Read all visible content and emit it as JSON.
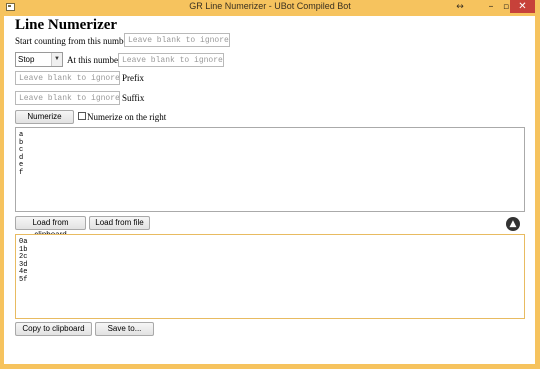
{
  "window": {
    "title": "GR Line Numerizer - UBot Compiled Bot",
    "resize_icon": "↔",
    "min_icon": "–",
    "max_icon": "▫",
    "close_icon": "✕"
  },
  "page": {
    "heading": "Line Numerizer"
  },
  "start": {
    "label": "Start counting from this number",
    "placeholder": "Leave blank to ignore"
  },
  "stop": {
    "select_value": "Stop",
    "label": "At this number",
    "placeholder": "Leave blank to ignore"
  },
  "prefix": {
    "placeholder": "Leave blank to ignore",
    "label": "Prefix"
  },
  "suffix": {
    "placeholder": "Leave blank to ignore",
    "label": "Suffix"
  },
  "actions": {
    "numerize_label": "Numerize",
    "right_checkbox_label": "Numerize on the right"
  },
  "input_text": "a\nb\nc\nd\ne\nf",
  "load": {
    "clipboard_label": "Load from clipboard",
    "file_label": "Load from file",
    "upload_icon": "arrow-up-circle-icon"
  },
  "output_text": "0a\n1b\n2c\n3d\n4e\n5f",
  "save": {
    "copy_label": "Copy to clipboard",
    "save_label": "Save to..."
  }
}
